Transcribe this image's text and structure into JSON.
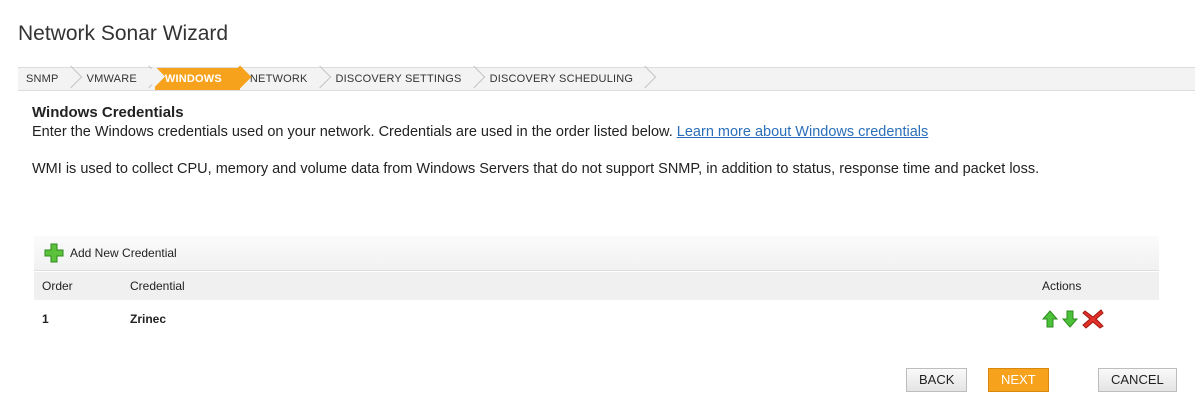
{
  "title": "Network Sonar Wizard",
  "steps": [
    {
      "label": "SNMP",
      "active": false
    },
    {
      "label": "VMWARE",
      "active": false
    },
    {
      "label": "WINDOWS",
      "active": true
    },
    {
      "label": "NETWORK",
      "active": false
    },
    {
      "label": "DISCOVERY SETTINGS",
      "active": false
    },
    {
      "label": "DISCOVERY SCHEDULING",
      "active": false
    }
  ],
  "section": {
    "title": "Windows Credentials",
    "intro": "Enter the Windows credentials used on your network. Credentials are used in the order listed below. ",
    "learn_more": "Learn more about Windows credentials",
    "wmi_text": "WMI is used to collect CPU, memory and volume data from Windows Servers that do not support SNMP, in addition to status, response time and packet loss."
  },
  "toolbar": {
    "add_label": "Add New Credential",
    "add_icon": "plus-icon"
  },
  "table": {
    "headers": {
      "order": "Order",
      "credential": "Credential",
      "actions": "Actions"
    },
    "rows": [
      {
        "order": "1",
        "credential": "Zrinec",
        "actions": [
          "move-up-icon",
          "move-down-icon",
          "delete-icon"
        ]
      }
    ]
  },
  "buttons": {
    "back": "BACK",
    "next": "NEXT",
    "cancel": "CANCEL"
  },
  "colors": {
    "accent": "#f7a21c",
    "link": "#2a6fb8",
    "arrow_green": "#3bb02f",
    "delete_red": "#d9281c"
  }
}
